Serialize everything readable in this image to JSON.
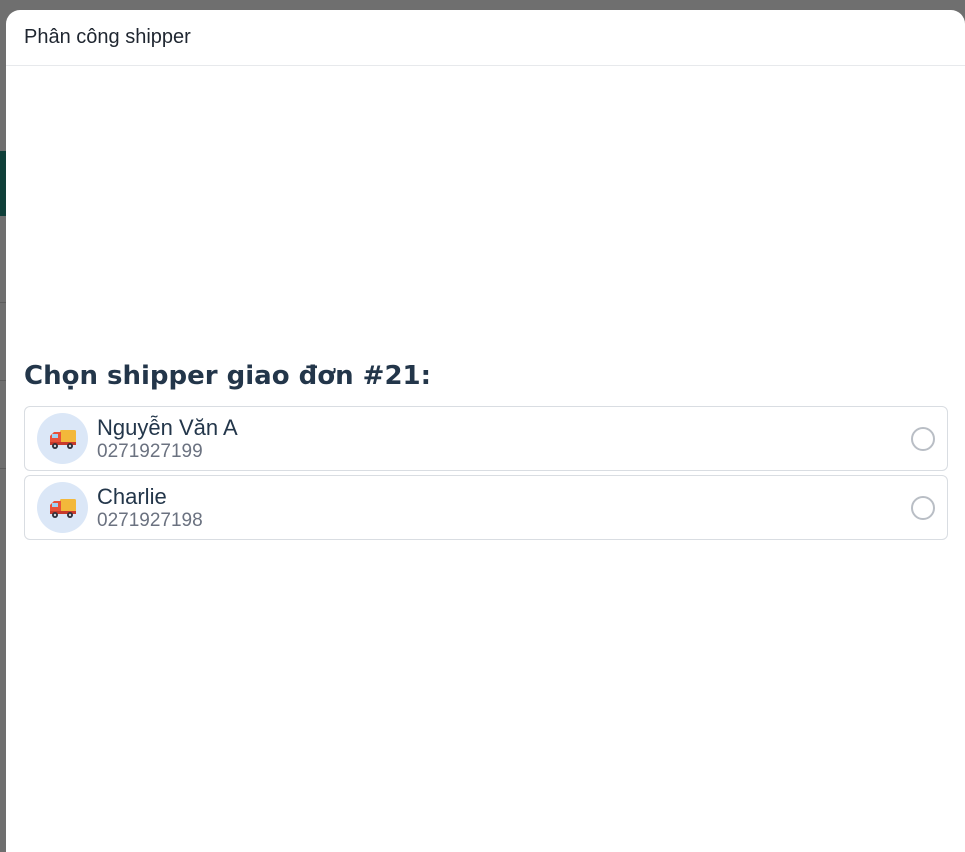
{
  "modal": {
    "title": "Phân công shipper"
  },
  "section": {
    "heading": "Chọn shipper giao đơn #21:"
  },
  "shippers": [
    {
      "name": "Nguyễn Văn A",
      "phone": "0271927199",
      "icon": "delivery-truck-icon",
      "selected": false
    },
    {
      "name": "Charlie",
      "phone": "0271927198",
      "icon": "delivery-truck-icon",
      "selected": false
    }
  ],
  "colors": {
    "heading": "#23364a",
    "avatar_bg": "#dbe7f7",
    "truck_cab": "#e8503a",
    "truck_box": "#f3b83a"
  }
}
